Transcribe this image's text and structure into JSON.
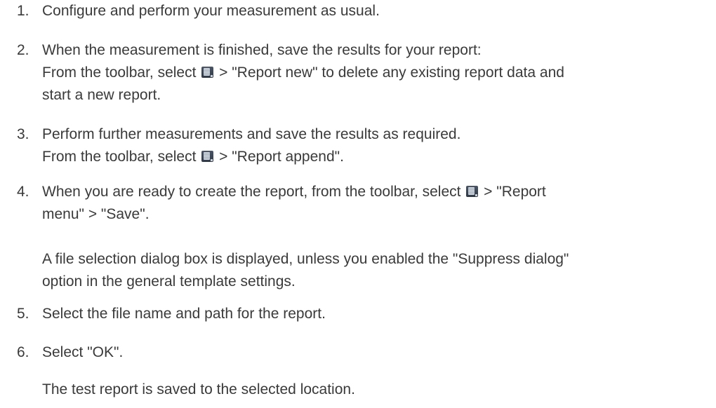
{
  "steps": [
    {
      "number": "1.",
      "lines": [
        "Configure and perform your measurement as usual."
      ]
    },
    {
      "number": "2.",
      "line1": "When the measurement is finished, save the results for your report:",
      "line2_before": "From the toolbar, select",
      "line2_after": "> \"Report new\" to delete any existing report data and",
      "line3": "start a new report."
    },
    {
      "number": "3.",
      "line1": "Perform further measurements and save the results as required.",
      "line2_before": "From the toolbar, select",
      "line2_after": "> \"Report append\"."
    },
    {
      "number": "4.",
      "line1_before": "When you are ready to create the report, from the toolbar, select",
      "line1_after": "> \"Report",
      "line2": "menu\" > \"Save\".",
      "note_line1": "A file selection dialog box is displayed, unless you enabled the \"Suppress dialog\"",
      "note_line2": "option in the general template settings."
    },
    {
      "number": "5.",
      "line1": "Select the file name and path for the report."
    },
    {
      "number": "6.",
      "line1": "Select \"OK\".",
      "note_line1": "The test report is saved to the selected location."
    }
  ],
  "icons": {
    "report": "report-menu-icon"
  }
}
